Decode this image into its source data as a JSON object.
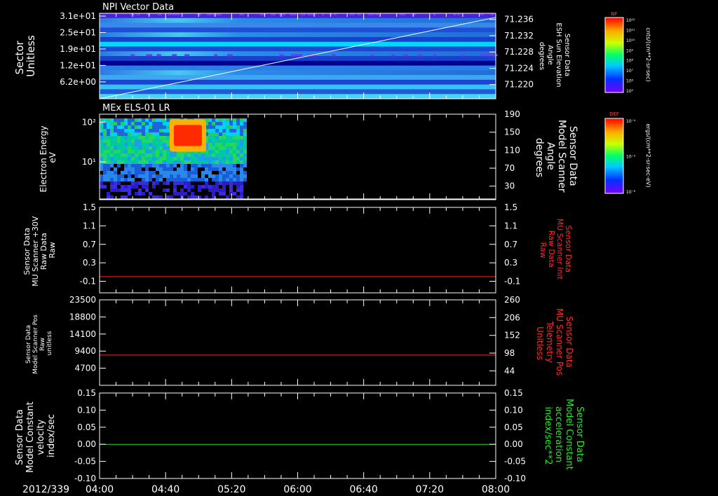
{
  "date_label": "2012/339",
  "time_axis": {
    "start": "04:00",
    "end": "08:00",
    "labels": [
      "04:00",
      "04:40",
      "05:20",
      "06:00",
      "06:40",
      "07:20",
      "08:00"
    ]
  },
  "colors": {
    "background": "#000000",
    "axis": "#ffffff",
    "red_trace": "#ff2020",
    "green_trace": "#22dd22",
    "red_label": "#ff2a2a",
    "green_label": "#22ee22"
  },
  "colorbars": [
    {
      "label": "NF",
      "units": "cnts/(cm**2-sr-sec)",
      "ticks": [
        "10¹²",
        "10¹¹",
        "10¹⁰",
        "10⁹",
        "10⁸",
        "10⁷",
        "10⁶",
        "10⁵"
      ]
    },
    {
      "label": "DEF",
      "units": "ergs/(cm**2-sr-sec-eV)",
      "ticks": [
        "10⁻⁴",
        "10⁻⁵",
        "10⁻⁶"
      ]
    }
  ],
  "chart_data": [
    {
      "type": "heatmap",
      "title": "NPI Vector Data",
      "ylabel_lines": [
        "Sector",
        "Unitless"
      ],
      "yticks": [
        "3.1e+01",
        "2.5e+01",
        "1.9e+01",
        "1.2e+01",
        "6.2e+00"
      ],
      "ylim": [
        0,
        31
      ],
      "y2label_lines": [
        "Sensor Data",
        "ESH Sun Elevation",
        "Angle",
        "degrees"
      ],
      "y2ticks": [
        71.236,
        71.232,
        71.228,
        71.224,
        71.22
      ],
      "y2lim": [
        71.2165,
        71.2375
      ],
      "overlay_series": {
        "name": "ESH Sun Elevation Angle",
        "x": [
          "04:00",
          "08:00"
        ],
        "values": [
          71.2165,
          71.2365
        ],
        "color": "#ffffff"
      }
    },
    {
      "type": "heatmap",
      "title": "MEx ELS-01 LR",
      "ylabel_lines": [
        "Electron Energy",
        "eV"
      ],
      "yticks": [
        "10²",
        "10¹"
      ],
      "ylim_log10": [
        0.05,
        2.2
      ],
      "y2label_lines": [
        "Sensor Data",
        "Model Scanner",
        "Angle",
        "degrees"
      ],
      "y2ticks": [
        190,
        150,
        110,
        70,
        30
      ],
      "y2lim": [
        0,
        190
      ],
      "data_end": "05:29",
      "hot_patch": {
        "x": [
          "04:45",
          "05:02"
        ],
        "energy_eV": [
          25,
          85
        ]
      },
      "overlay_series": {
        "name": "Model Scanner Angle",
        "x": [
          "04:00",
          "08:00"
        ],
        "values": [
          0,
          0
        ],
        "color": "#ffffff"
      }
    },
    {
      "type": "line",
      "ylabel_lines": [
        "Sensor Data",
        "MU Scanner +30V",
        "Raw Data",
        "Raw"
      ],
      "yticks": [
        1.5,
        1.1,
        0.7,
        0.3,
        -0.1
      ],
      "ylim": [
        -0.35,
        1.5
      ],
      "y2label_lines": [
        "Sensor Data",
        "MU Scanner Init",
        "Raw Data",
        "Raw"
      ],
      "y2ticks": [
        1.5,
        1.1,
        0.7,
        0.3,
        -0.1
      ],
      "y2lim": [
        -0.35,
        1.5
      ],
      "series": [
        {
          "x": [
            "04:00",
            "08:00"
          ],
          "values": [
            0.0,
            0.0
          ],
          "color": "#ff2020"
        }
      ]
    },
    {
      "type": "line",
      "ylabel_lines": [
        "Sensor Data",
        "Model Scanner Pos",
        "Raw",
        "unitless"
      ],
      "yticks": [
        23500,
        18800,
        14100,
        9400,
        4700
      ],
      "ylim": [
        0,
        23500
      ],
      "y2label_lines": [
        "Sensor Data",
        "MU Scanner Pos",
        "Telemetry",
        "Unitless"
      ],
      "y2ticks": [
        260,
        206,
        152,
        98,
        44
      ],
      "y2lim": [
        0,
        260
      ],
      "series": [
        {
          "x": [
            "04:00",
            "08:00"
          ],
          "values": [
            8300,
            8300
          ],
          "color": "#ff2020"
        }
      ]
    },
    {
      "type": "line",
      "ylabel_lines": [
        "Sensor Data",
        "Model Constant",
        "velocity",
        "index/sec"
      ],
      "yticks": [
        "0.15",
        "0.10",
        "0.05",
        "0.00",
        "-0.05",
        "-0.10"
      ],
      "ylim": [
        -0.1,
        0.15
      ],
      "y2label_lines": [
        "Sensor Data",
        "Model Constant",
        "acceleration",
        "index/sec**2"
      ],
      "y2ticks": [
        "0.15",
        "0.10",
        "0.05",
        "0.00",
        "-0.05",
        "-0.10"
      ],
      "y2lim": [
        -0.1,
        0.15
      ],
      "series": [
        {
          "x": [
            "04:00",
            "08:00"
          ],
          "values": [
            0.0,
            0.0
          ],
          "color": "#22dd22"
        }
      ]
    }
  ]
}
